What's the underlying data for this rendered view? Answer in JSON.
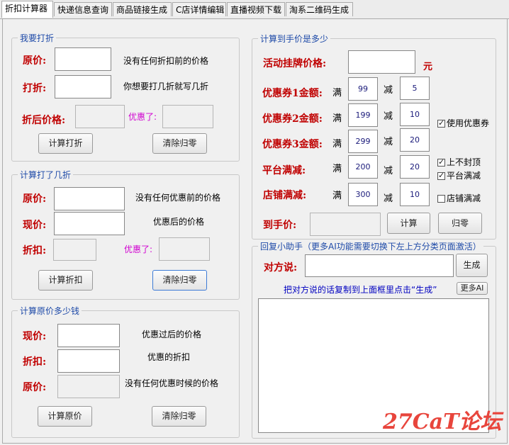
{
  "tabs": [
    "折扣计算器",
    "快递信息查询",
    "商品链接生成",
    "C店详情编辑",
    "直播视频下载",
    "淘系二维码生成"
  ],
  "group1": {
    "title": "我要打折",
    "original_label": "原价:",
    "original_hint": "没有任何折扣前的价格",
    "discount_label": "打折:",
    "discount_hint": "你想要打几折就写几折",
    "after_label": "折后价格:",
    "saved_label": "优惠了:",
    "calc_button": "计算打折",
    "clear_button": "清除归零"
  },
  "group2": {
    "title": "计算打了几折",
    "original_label": "原价:",
    "original_hint": "没有任何优惠前的价格",
    "current_label": "现价:",
    "current_hint": "优惠后的价格",
    "discount_label": "折扣:",
    "saved_label": "优惠了:",
    "calc_button": "计算折扣",
    "clear_button": "清除归零"
  },
  "group3": {
    "title": "计算原价多少钱",
    "current_label": "现价:",
    "current_hint": "优惠过后的价格",
    "discount_label": "折扣:",
    "discount_hint": "优惠的折扣",
    "original_label": "原价:",
    "original_hint": "没有任何优惠时候的价格",
    "calc_button": "计算原价",
    "clear_button": "清除归零"
  },
  "group4": {
    "title": "计算到手价是多少",
    "list_price_label": "活动挂牌价格:",
    "unit": "元",
    "coupon1_label": "优惠券1金额:",
    "coupon2_label": "优惠券2金额:",
    "coupon3_label": "优惠券3金额:",
    "platform_label": "平台满减:",
    "store_label": "店铺满减:",
    "man": "满",
    "jian": "减",
    "coupon1": {
      "threshold": "99",
      "minus": "5"
    },
    "coupon2": {
      "threshold": "199",
      "minus": "10"
    },
    "coupon3": {
      "threshold": "299",
      "minus": "20"
    },
    "platform": {
      "threshold": "200",
      "minus": "20"
    },
    "store": {
      "threshold": "300",
      "minus": "10"
    },
    "use_coupon": "使用优惠券",
    "no_cap": "上不封顶",
    "platform_check": "平台满减",
    "store_check": "店铺满减",
    "final_label": "到手价:",
    "calc_button": "计算",
    "clear_button": "归零"
  },
  "group5": {
    "title": "回复小助手（更多AI功能需要切换下左上方分类页面激活）",
    "other_label": "对方说:",
    "generate_button": "生成",
    "instruction": "把对方说的话复制到上面框里点击“生成”",
    "more_ai_button": "更多AI"
  },
  "watermark": "27CaT论坛"
}
